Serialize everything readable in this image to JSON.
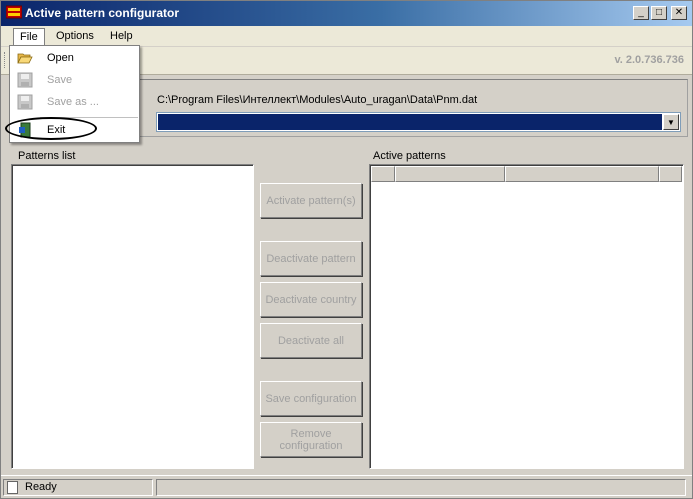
{
  "window": {
    "title": "Active pattern configurator"
  },
  "menubar": {
    "file": "File",
    "options": "Options",
    "help": "Help"
  },
  "toolbar": {
    "version": "v. 2.0.736.736"
  },
  "database": {
    "path": "C:\\Program Files\\Интеллект\\Modules\\Auto_uragan\\Data\\Pnm.dat",
    "combo_value": ""
  },
  "patterns_list": {
    "label": "Patterns list",
    "items": []
  },
  "active_patterns": {
    "label": "Active patterns",
    "columns": [
      "",
      "",
      "",
      ""
    ],
    "rows": []
  },
  "buttons": {
    "activate": "Activate pattern(s)",
    "deactivate_pattern": "Deactivate pattern",
    "deactivate_country": "Deactivate country",
    "deactivate_all": "Deactivate all",
    "save_configuration": "Save configuration",
    "remove_configuration": "Remove configuration"
  },
  "statusbar": {
    "text": "Ready"
  },
  "file_menu": {
    "items": [
      {
        "label": "Open",
        "enabled": true,
        "icon": "folder-open-icon"
      },
      {
        "label": "Save",
        "enabled": false,
        "icon": "floppy-disk-icon"
      },
      {
        "label": "Save as ...",
        "enabled": false,
        "icon": "floppy-disk-icon"
      },
      {
        "label": "Exit",
        "enabled": true,
        "icon": "exit-door-icon"
      }
    ]
  },
  "colors": {
    "titlebar": "#0a246a",
    "combo_selected": "#0a246a",
    "highlight_ring": "#000000"
  }
}
